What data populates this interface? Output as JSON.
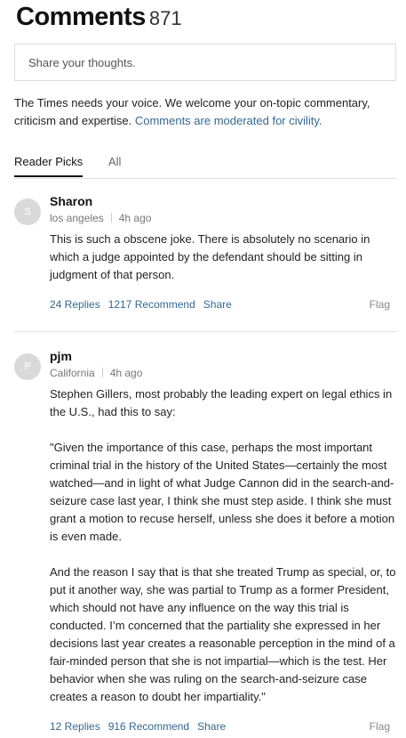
{
  "header": {
    "title": "Comments",
    "count": "871"
  },
  "input": {
    "placeholder": "Share your thoughts."
  },
  "intro": {
    "text": "The Times needs your voice. We welcome your on-topic commentary, criticism and expertise. ",
    "link": "Comments are moderated for civility."
  },
  "tabs": [
    {
      "label": "Reader Picks"
    },
    {
      "label": "All"
    }
  ],
  "comments": [
    {
      "avatar": "S",
      "name": "Sharon",
      "location": "los angeles",
      "time": "4h ago",
      "paragraphs": [
        "This is such a obscene joke.  There is absolutely no scenario in which a judge appointed by the defendant should be sitting in judgment of that person."
      ],
      "replies": "24 Replies",
      "recommend": "1217 Recommend",
      "share": "Share",
      "flag": "Flag"
    },
    {
      "avatar": "P",
      "name": "pjm",
      "location": "California",
      "time": "4h ago",
      "paragraphs": [
        "Stephen Gillers, most probably the leading expert on legal ethics in the U.S., had this to say:",
        "\"Given the importance of this case, perhaps the most important criminal trial in the history of the United States—certainly the most watched—and in light of what Judge Cannon did in the search-and-seizure case last year, I think she must step aside. I think she must grant a motion to recuse herself, unless she does it before a motion is even made.",
        "And the reason I say that is that she treated Trump as special, or, to put it another way, she was partial to Trump as a former President, which should not have any influence on the way this trial is conducted. I’m concerned that the partiality she expressed in her decisions last year creates a reasonable perception in the mind of a fair-minded person that she is not impartial—which is the test. Her behavior when she was ruling on the search-and-seizure case creates a reason to doubt her impartiality.\""
      ],
      "replies": "12 Replies",
      "recommend": "916 Recommend",
      "share": "Share",
      "flag": "Flag"
    }
  ]
}
